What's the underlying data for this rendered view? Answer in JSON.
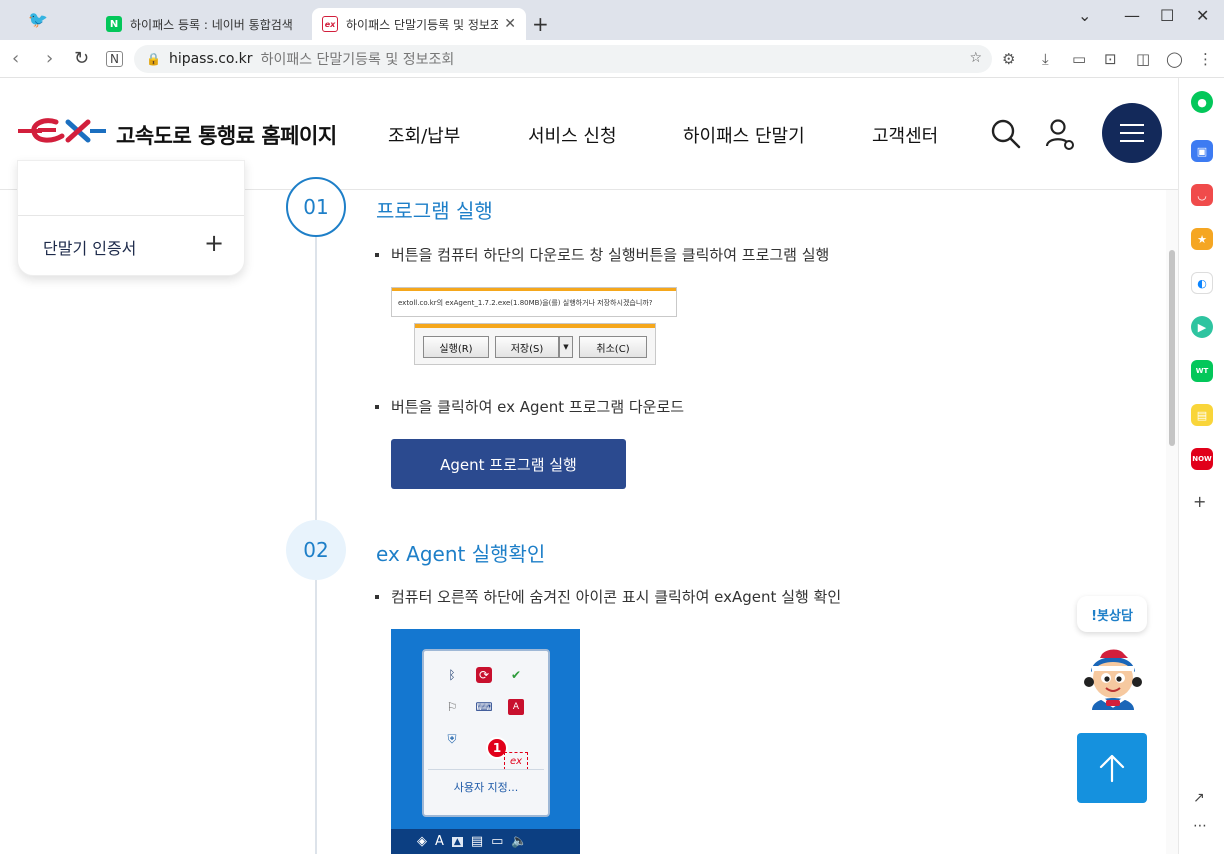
{
  "browser": {
    "tabs": [
      {
        "label": "하이패스 등록 : 네이버 통합검색",
        "favicon": "N",
        "active": false
      },
      {
        "label": "하이패스 단말기등록 및 정보조회",
        "favicon": "ex",
        "active": true
      }
    ],
    "address": {
      "host": "hipass.co.kr",
      "page_title": "하이패스 단말기등록 및 정보조회"
    }
  },
  "header": {
    "site_name": "고속도로 통행료 홈페이지",
    "nav": [
      "조회/납부",
      "서비스 신청",
      "하이패스 단말기",
      "고객센터"
    ],
    "colors": {
      "brand_navy": "#13295a",
      "accent_blue": "#1e7fc8",
      "logo_red": "#d21f3c"
    }
  },
  "sidebar": {
    "item_label": "단말기 인증서",
    "expand_symbol": "+"
  },
  "steps": [
    {
      "number": "01",
      "title": "프로그램 실행",
      "desc1": "버튼을 컴퓨터 하단의 다운로드 창 실행버튼을 클릭하여 프로그램 실행",
      "download_prompt": "extoll.co.kr의 exAgent_1.7.2.exe(1.80MB)을(를) 실행하거나 저장하시겠습니까?",
      "dialog_buttons": [
        "실행(R)",
        "저장(S)",
        "취소(C)"
      ],
      "desc2": "버튼을 클릭하여 ex Agent 프로그램 다운로드",
      "button_label": "Agent 프로그램 실행"
    },
    {
      "number": "02",
      "title": "ex Agent 실행확인",
      "desc1": "컴퓨터 오른쪽 하단에 숨겨진 아이콘 표시 클릭하여 exAgent 실행 확인",
      "tray_customize": "사용자 지정...",
      "tray_badge": "1",
      "tray_ex_label": "ex"
    }
  ],
  "chatbot": {
    "label": "!봇상담"
  }
}
